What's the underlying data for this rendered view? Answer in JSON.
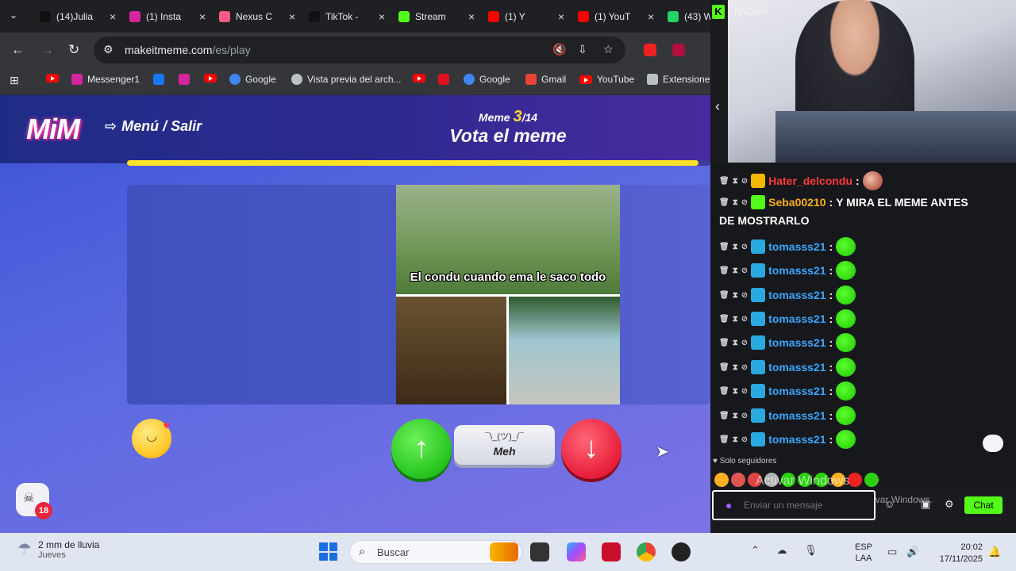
{
  "browser": {
    "tabs": [
      {
        "label": "(14)Julia",
        "icon": "tiktok-icon"
      },
      {
        "label": "(1) Insta",
        "icon": "instagram-icon"
      },
      {
        "label": "Nexus C",
        "icon": "nexus-icon"
      },
      {
        "label": "TikTok -",
        "icon": "tiktok-icon"
      },
      {
        "label": "Stream",
        "icon": "kick-icon"
      },
      {
        "label": "(1) Y",
        "icon": "youtube-icon"
      },
      {
        "label": "(1) YouT",
        "icon": "youtube-icon"
      },
      {
        "label": "(43) W",
        "icon": "whatsapp-icon"
      }
    ],
    "url_host": "makeitmeme.com",
    "url_path": "/es/play",
    "bookmarks": [
      {
        "label": "",
        "icon": "youtube-icon"
      },
      {
        "label": "Messenger1",
        "icon": "instagram-icon"
      },
      {
        "label": "",
        "icon": "facebook-icon"
      },
      {
        "label": "",
        "icon": "instagram-icon"
      },
      {
        "label": "",
        "icon": "youtube-icon"
      },
      {
        "label": "Google",
        "icon": "google-icon"
      },
      {
        "label": "Vista previa del arch...",
        "icon": "globe-icon"
      },
      {
        "label": "",
        "icon": "youtube-icon"
      },
      {
        "label": "",
        "icon": "red-app-icon"
      },
      {
        "label": "Google",
        "icon": "google-icon"
      },
      {
        "label": "Gmail",
        "icon": "gmail-icon"
      },
      {
        "label": "YouTube",
        "icon": "youtube-icon"
      },
      {
        "label": "Extensione",
        "icon": "puzzle-icon"
      }
    ]
  },
  "game": {
    "logo": "MiM",
    "menu_label": "Menú / Salir",
    "meme_word": "Meme",
    "meme_current": "3",
    "meme_total": "/14",
    "vote_title": "Vota el meme",
    "progress_fraction": 0.98,
    "meme_caption": "El condu cuando ema le saco todo",
    "meh_shrug": "¯\\_(ツ)_/¯",
    "meh_label": "Meh",
    "age_badge": "18"
  },
  "stream": {
    "cam_label": "iVCam",
    "messages": [
      {
        "user": "Hater_delcondu",
        "text": "",
        "color": "#ff3b3b",
        "badge_color": "#f5b800"
      },
      {
        "user": "Seba00210",
        "text": "Y MIRA EL MEME ANTES",
        "color": "#ffb020",
        "badge_color": "#53fc18"
      },
      {
        "user": "tomasss21",
        "text": "",
        "color": "#3aa7ff",
        "badge_color": "#2aa9e0"
      },
      {
        "user": "tomasss21",
        "text": "",
        "color": "#3aa7ff",
        "badge_color": "#2aa9e0"
      },
      {
        "user": "tomasss21",
        "text": "",
        "color": "#3aa7ff",
        "badge_color": "#2aa9e0"
      },
      {
        "user": "tomasss21",
        "text": "",
        "color": "#3aa7ff",
        "badge_color": "#2aa9e0"
      },
      {
        "user": "tomasss21",
        "text": "",
        "color": "#3aa7ff",
        "badge_color": "#2aa9e0"
      },
      {
        "user": "tomasss21",
        "text": "",
        "color": "#3aa7ff",
        "badge_color": "#2aa9e0"
      },
      {
        "user": "tomasss21",
        "text": "",
        "color": "#3aa7ff",
        "badge_color": "#2aa9e0"
      },
      {
        "user": "tomasss21",
        "text": "",
        "color": "#3aa7ff",
        "badge_color": "#2aa9e0"
      },
      {
        "user": "tomasss21",
        "text": "",
        "color": "#3aa7ff",
        "badge_color": "#2aa9e0"
      }
    ],
    "seba_continuation": "DE MOSTRARLO",
    "followers_only": "Solo seguidores",
    "input_placeholder": "Enviar un mensaje",
    "chat_button": "Chat",
    "watermark_title": "Activar Windows",
    "watermark_sub": "Ve a Configuración para activar Windows."
  },
  "taskbar": {
    "weather_main": "2 mm de lluvia",
    "weather_sub": "Jueves",
    "search_placeholder": "Buscar",
    "lang_top": "ESP",
    "lang_bottom": "LAA",
    "time": "20:02",
    "date": "17/11/2025"
  }
}
